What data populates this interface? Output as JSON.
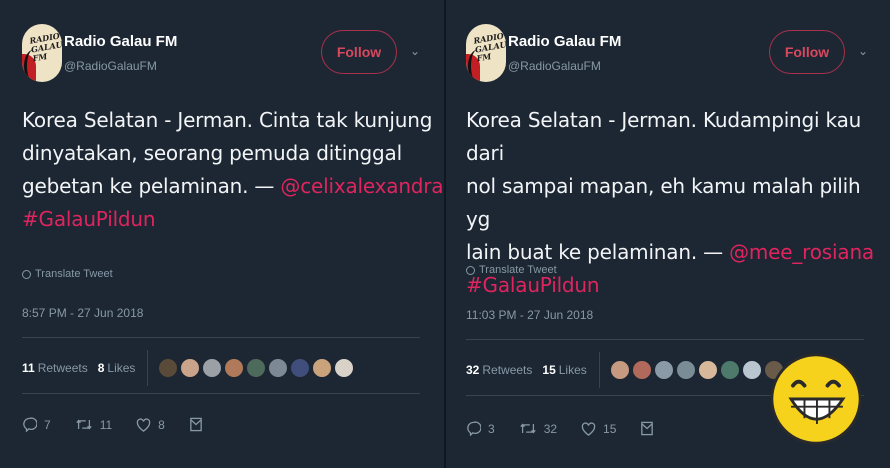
{
  "tweets": [
    {
      "account_name": "Radio Galau FM",
      "handle": "@RadioGalauFM",
      "avatar_text": "RADIO GALAU FM",
      "follow_label": "Follow",
      "text_line1": "Korea Selatan - Jerman. Cinta tak kunjung",
      "text_line2": "dinyatakan, seorang pemuda ditinggal",
      "text_line3_prefix": "gebetan ke pelaminan. — ",
      "mention": "@celixalexandra",
      "hashtag": "#GalauPildun",
      "translate_label": "Translate Tweet",
      "timestamp": "8:57 PM - 27 Jun 2018",
      "retweets_count": "11",
      "retweets_label": "Retweets",
      "likes_count": "8",
      "likes_label": "Likes",
      "reply_count": "7",
      "retweet_action_count": "11",
      "like_action_count": "8",
      "liker_colors": [
        "#5a4a3a",
        "#c9a48a",
        "#9aa0a6",
        "#b07a5a",
        "#4d6b5a",
        "#7d8a96",
        "#3f4e7a",
        "#caa27c",
        "#d9d2c8"
      ]
    },
    {
      "account_name": "Radio Galau FM",
      "handle": "@RadioGalauFM",
      "avatar_text": "RADIO GALAU FM",
      "follow_label": "Follow",
      "text_line1": "Korea Selatan - Jerman. Kudampingi kau dari",
      "text_line2": "nol sampai mapan, eh kamu malah pilih yg",
      "text_line3_prefix": "lain buat ke pelaminan. — ",
      "mention": "@mee_rosiana",
      "hashtag": "#GalauPildun",
      "translate_label": "Translate Tweet",
      "timestamp": "11:03 PM - 27 Jun 2018",
      "retweets_count": "32",
      "retweets_label": "Retweets",
      "likes_count": "15",
      "likes_label": "Likes",
      "reply_count": "3",
      "retweet_action_count": "32",
      "like_action_count": "15",
      "liker_colors": [
        "#c59a80",
        "#b0695a",
        "#8a9aa6",
        "#7a8c96",
        "#d8b89a",
        "#4d7a6a",
        "#b9c6d0",
        "#6a5a4a",
        "#a88a6a"
      ]
    }
  ],
  "colors": {
    "background": "#1c2733",
    "accent": "#e0245e",
    "muted": "#8899a6",
    "divider": "#38444d"
  },
  "icons": [
    "globe-icon",
    "reply-icon",
    "retweet-icon",
    "heart-icon",
    "message-icon",
    "chevron-down-icon",
    "laughing-smiley-icon"
  ]
}
